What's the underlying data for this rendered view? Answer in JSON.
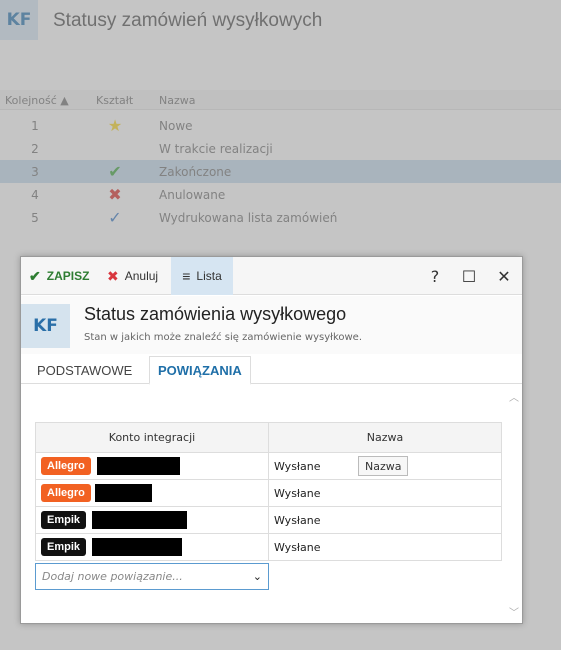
{
  "background": {
    "logo": "KF",
    "title": "Statusy zamówień wysyłkowych",
    "columns": {
      "order": "Kolejność ▲",
      "shape": "Kształt",
      "name": "Nazwa"
    },
    "rows": [
      {
        "num": "1",
        "shape": "★",
        "name": "Nowe"
      },
      {
        "num": "2",
        "shape": "",
        "name": "W trakcie realizacji"
      },
      {
        "num": "3",
        "shape": "✔",
        "name": "Zakończone"
      },
      {
        "num": "4",
        "shape": "✖",
        "name": "Anulowane"
      },
      {
        "num": "5",
        "shape": "✓",
        "name": "Wydrukowana lista zamówień"
      }
    ]
  },
  "dialog": {
    "toolbar": {
      "save_icon": "✔",
      "save_label": "ZAPISZ",
      "cancel_icon": "✖",
      "cancel_label": "Anuluj",
      "list_icon": "≡",
      "list_label": "Lista",
      "help_icon": "?",
      "maximize_icon": "☐",
      "close_icon": "✕"
    },
    "header": {
      "logo": "KF",
      "title": "Status zamówienia wysyłkowego",
      "subtitle": "Stan w jakich może znaleźć się zamówienie wysyłkowe."
    },
    "tabs": [
      "PODSTAWOWE",
      "POWIĄZANIA"
    ],
    "grid": {
      "col_account": "Konto integracji",
      "col_name": "Nazwa",
      "rows": [
        {
          "badge": "Allegro",
          "name": "Wysłane",
          "button": "Nazwa"
        },
        {
          "badge": "Allegro",
          "name": "Wysłane"
        },
        {
          "badge": "Empik",
          "name": "Wysłane"
        },
        {
          "badge": "Empik",
          "name": "Wysłane"
        }
      ]
    },
    "add_placeholder": "Dodaj nowe powiązanie...",
    "colors": {
      "allegro": "#f26122",
      "empik": "#111111",
      "accent": "#1f6fa8"
    }
  }
}
